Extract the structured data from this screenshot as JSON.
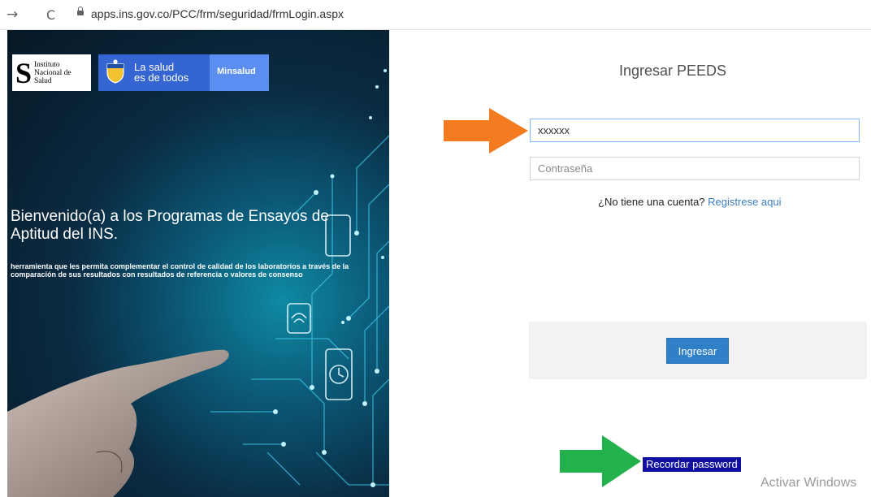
{
  "browser": {
    "back_glyph": "→",
    "reload_glyph": "C",
    "url": "apps.ins.gov.co/PCC/frm/seguridad/frmLogin.aspx"
  },
  "hero": {
    "ins_logo": [
      "Instituto",
      "Nacional de",
      "Salud"
    ],
    "minsalud_slogan": [
      "La salud",
      "es de todos"
    ],
    "minsalud_name": "Minsalud",
    "title": "Bienvenido(a) a los Programas de Ensayos de Aptitud del INS.",
    "description": "herramienta que les permita complementar el control de calidad de los laboratorios a través de la comparación de sus resultados con resultados de referencia o valores de consenso"
  },
  "login": {
    "title": "Ingresar PEEDS",
    "username_value": "xxxxxx",
    "password_placeholder": "Contraseña",
    "no_account_text": "¿No tiene una cuenta?",
    "register_link": "Registrese aqui",
    "submit_label": "Ingresar",
    "forgot_link": "Recordar password"
  },
  "annotations": {
    "orange_arrow_color": "#f47b20",
    "green_arrow_color": "#22b14c"
  },
  "watermark": "Activar Windows"
}
